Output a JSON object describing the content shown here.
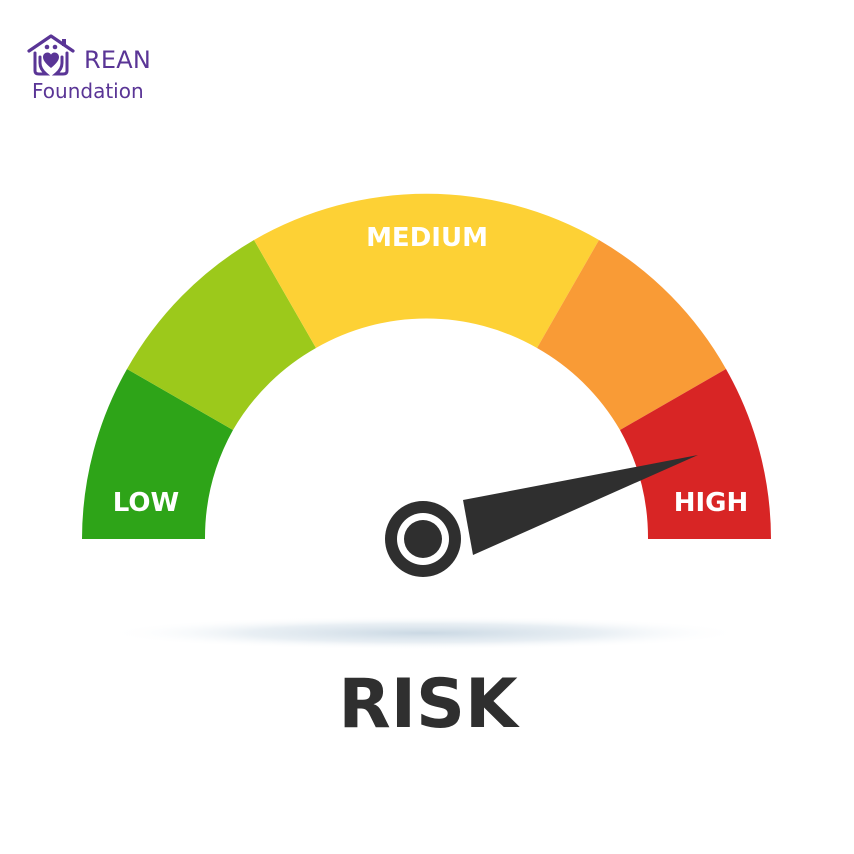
{
  "logo": {
    "line1": "REAN",
    "line2": "Foundation",
    "icon": "house-heart-hands-icon",
    "color": "#5a3596"
  },
  "gauge": {
    "zones": [
      {
        "name": "low",
        "color": "#2ea418"
      },
      {
        "name": "low-medium",
        "color": "#9cc91b"
      },
      {
        "name": "medium",
        "color": "#fdd135"
      },
      {
        "name": "medium-high",
        "color": "#f99b36"
      },
      {
        "name": "high",
        "color": "#d82525"
      }
    ],
    "labels": {
      "low": "LOW",
      "medium": "MEDIUM",
      "high": "HIGH"
    },
    "needle_color": "#2f2f2f"
  },
  "title": "RISK"
}
